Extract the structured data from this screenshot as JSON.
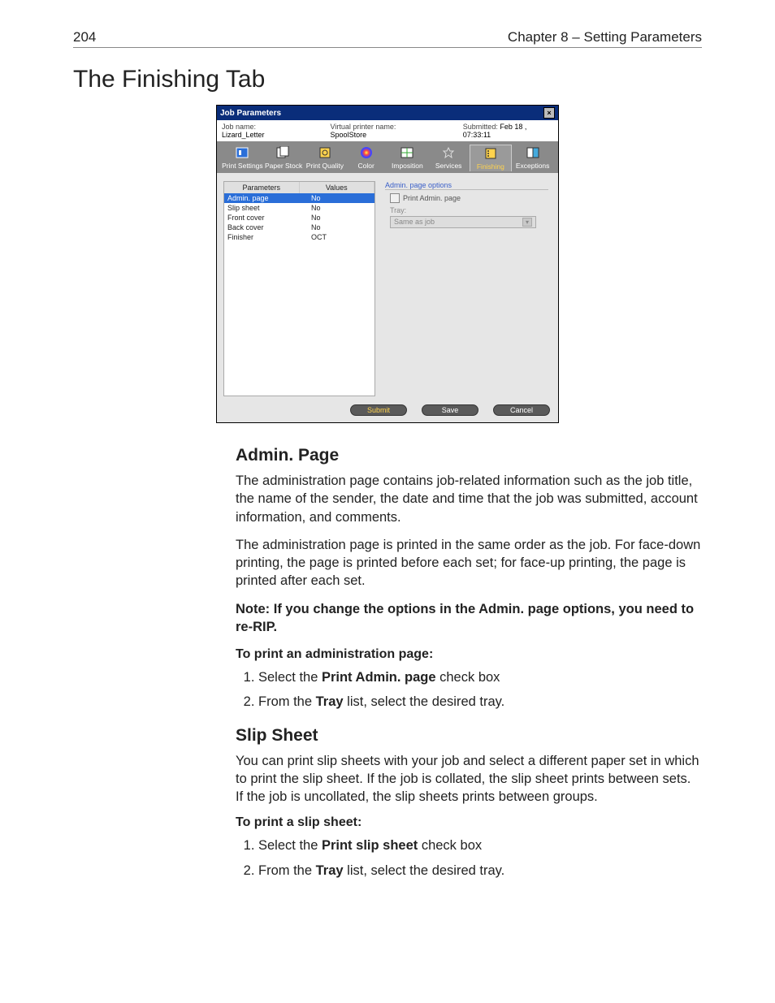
{
  "header": {
    "page_number": "204",
    "chapter": "Chapter 8 – Setting Parameters"
  },
  "title": "The Finishing Tab",
  "dialog": {
    "title": "Job Parameters",
    "job_name_label": "Job name:",
    "job_name": "Lizard_Letter",
    "vp_label": "Virtual printer name:",
    "vp_name": "SpoolStore",
    "submitted_label": "Submitted:",
    "submitted": "Feb 18 , 07:33:11",
    "tabs": [
      {
        "label": "Print Settings"
      },
      {
        "label": "Paper Stock"
      },
      {
        "label": "Print Quality"
      },
      {
        "label": "Color"
      },
      {
        "label": "Imposition"
      },
      {
        "label": "Services"
      },
      {
        "label": "Finishing"
      },
      {
        "label": "Exceptions"
      }
    ],
    "param_col": "Parameters",
    "value_col": "Values",
    "rows": [
      {
        "name": "Admin. page",
        "value": "No"
      },
      {
        "name": "Slip sheet",
        "value": "No"
      },
      {
        "name": "Front cover",
        "value": "No"
      },
      {
        "name": "Back cover",
        "value": "No"
      },
      {
        "name": "Finisher",
        "value": "OCT"
      }
    ],
    "options_title": "Admin. page options",
    "checkbox_label": "Print Admin. page",
    "tray_label": "Tray:",
    "tray_value": "Same as job",
    "submit": "Submit",
    "save": "Save",
    "cancel": "Cancel"
  },
  "admin": {
    "heading": "Admin. Page",
    "para1": "The administration page contains job-related information such as the job title, the name of the sender, the date and time that the job was submitted, account information, and comments.",
    "para2": "The administration page is printed in the same order as the job. For face-down printing, the page is printed before each set; for face-up printing, the page is printed after each set.",
    "note_lead": "Note:  ",
    "note_a": "If you change the options in the ",
    "note_b": "Admin. page",
    "note_c": " options, you need to re-RIP.",
    "subhead": "To print an administration page:",
    "step1a": "Select the ",
    "step1b": "Print Admin. page",
    "step1c": " check box",
    "step2a": "From the ",
    "step2b": "Tray",
    "step2c": " list, select the desired tray."
  },
  "slip": {
    "heading": "Slip Sheet",
    "para": "You can print slip sheets with your job and select a different paper set in which to print the slip sheet. If the job is collated, the slip sheet prints between sets. If the job is uncollated, the slip sheets prints between groups.",
    "subhead": "To print a slip sheet:",
    "step1a": "Select the ",
    "step1b": "Print slip sheet",
    "step1c": " check box",
    "step2a": "From the ",
    "step2b": "Tray",
    "step2c": " list, select the desired tray."
  }
}
